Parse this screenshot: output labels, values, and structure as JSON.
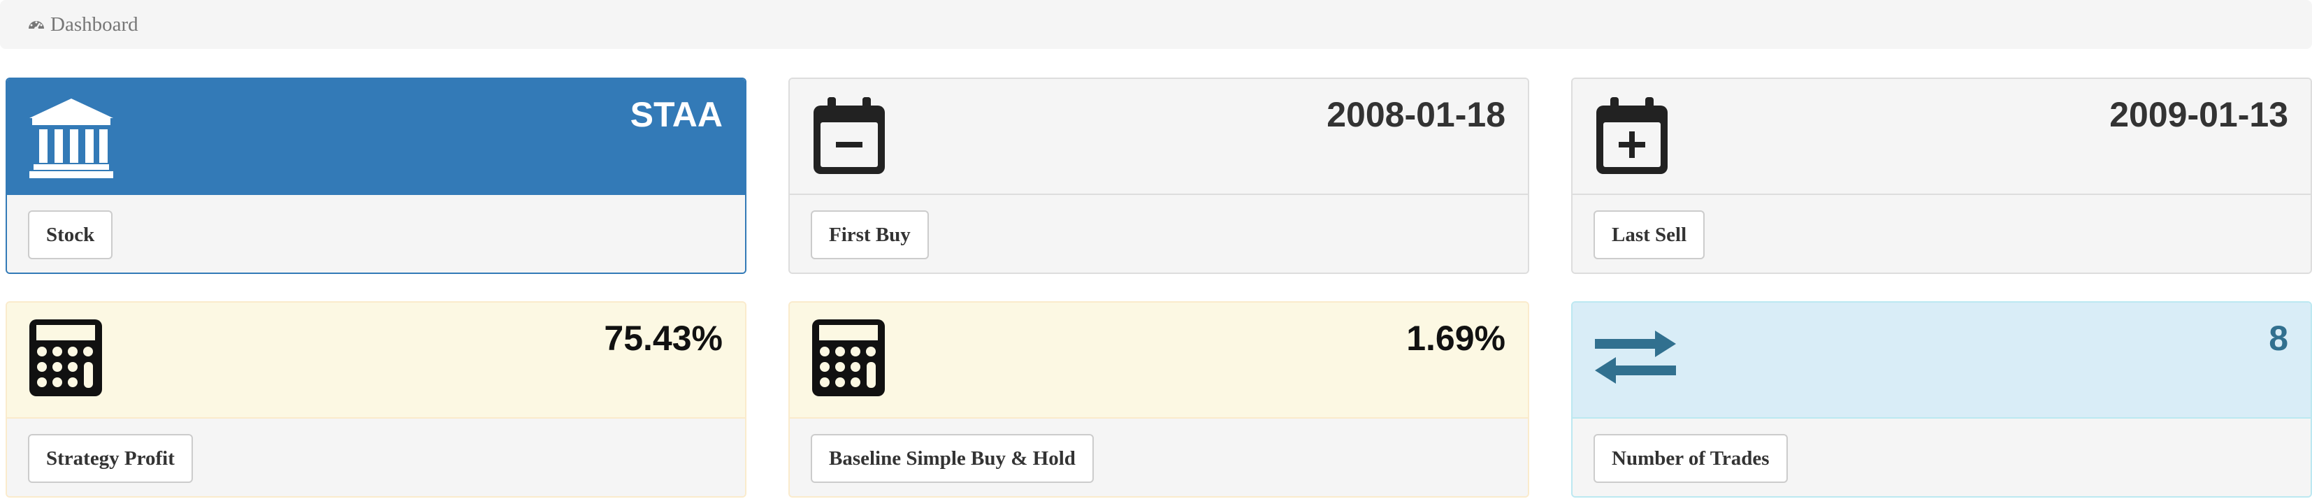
{
  "breadcrumb": {
    "icon": "dashboard-icon",
    "label": "Dashboard"
  },
  "cards": [
    {
      "id": "stock",
      "style": "primary",
      "icon": "bank-icon",
      "value": "STAA",
      "label": "Stock"
    },
    {
      "id": "first-buy",
      "style": "neutral",
      "icon": "calendar-minus-icon",
      "value": "2008-01-18",
      "label": "First Buy"
    },
    {
      "id": "last-sell",
      "style": "neutral",
      "icon": "calendar-plus-icon",
      "value": "2009-01-13",
      "label": "Last Sell"
    },
    {
      "id": "strategy-profit",
      "style": "warning",
      "icon": "calculator-icon",
      "value": "75.43%",
      "label": "Strategy Profit"
    },
    {
      "id": "baseline",
      "style": "warning",
      "icon": "calculator-icon",
      "value": "1.69%",
      "label": "Baseline Simple Buy & Hold"
    },
    {
      "id": "trades",
      "style": "info",
      "icon": "exchange-arrows-icon",
      "value": "8",
      "label": "Number of Trades"
    }
  ],
  "colors": {
    "primary": "#337ab7",
    "warning_bg": "#fcf8e3",
    "info_bg": "#d9edf7",
    "info_text": "#31708f"
  }
}
